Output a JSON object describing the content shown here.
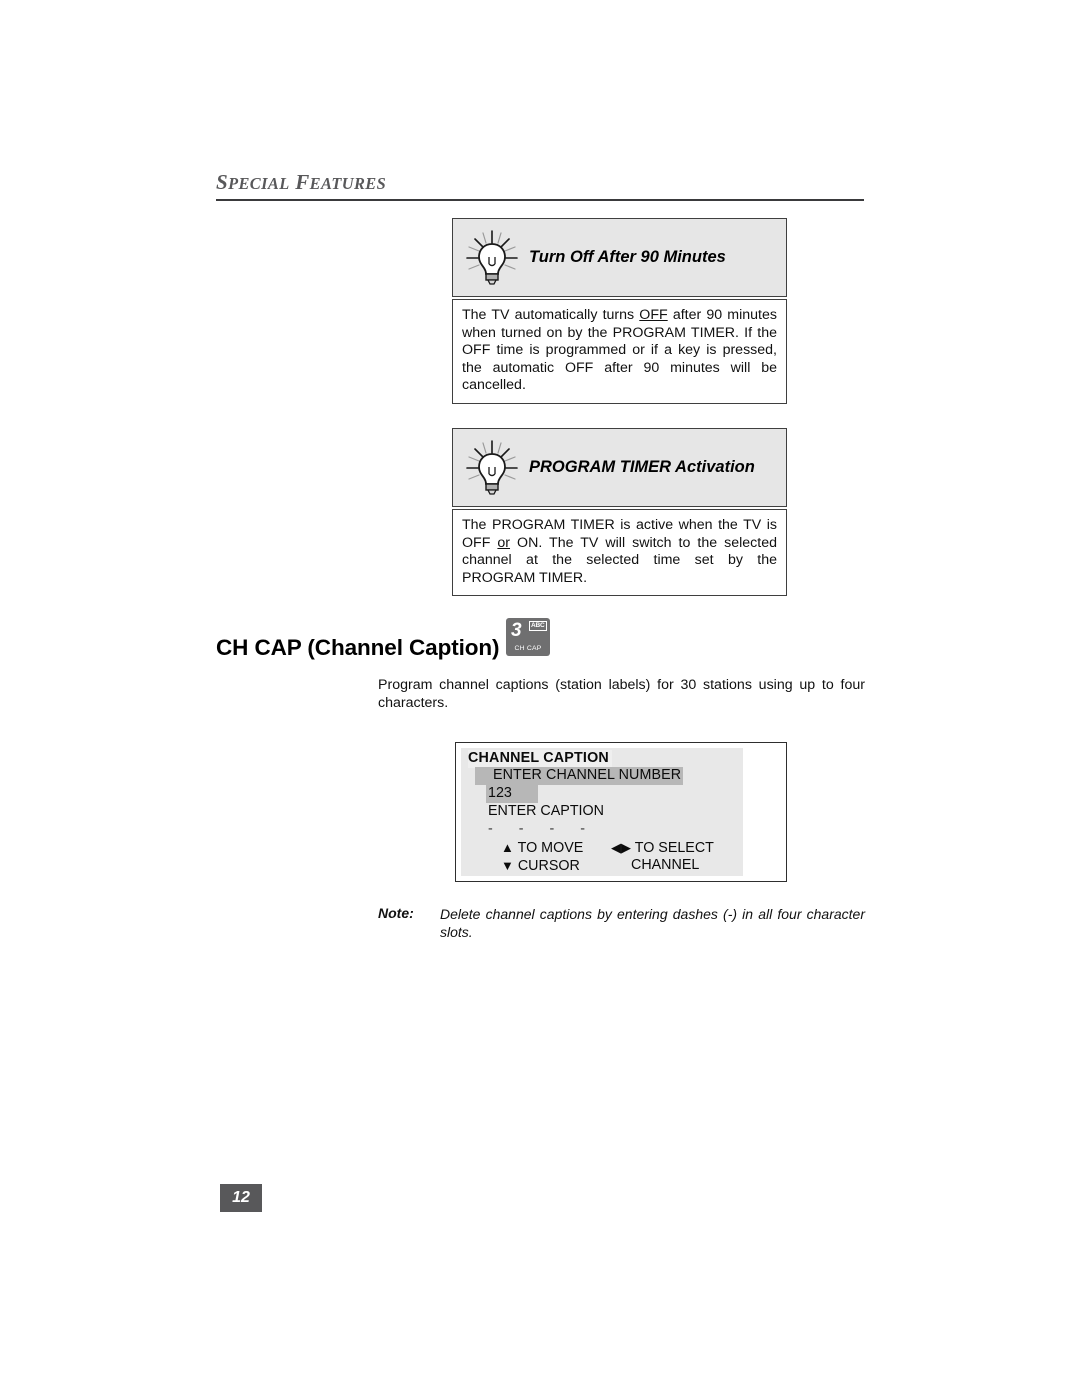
{
  "section_header": {
    "title": "SPECIAL FEATURES"
  },
  "tips": [
    {
      "icon": "lightbulb-icon",
      "title": "Turn Off After 90 Minutes",
      "body": "The TV automatically turns OFF after 90 minutes when turned on by the PROGRAM TIMER.  If the OFF time is programmed or if a key is pressed, the automatic OFF after 90 minutes will be cancelled.",
      "body_pre": "The TV automatically turns ",
      "body_underline": "OFF",
      "body_post": " after 90 minutes when turned on by the PROGRAM TIMER.  If the OFF time is programmed or if a key is pressed, the automatic OFF after 90 minutes will be cancelled."
    },
    {
      "icon": "lightbulb-icon",
      "title": "PROGRAM TIMER Activation",
      "body": "The PROGRAM TIMER is active when the TV is OFF or ON.  The TV will switch to the selected channel at the selected time set by the PROGRAM TIMER.",
      "body_pre": "The PROGRAM TIMER is active when the TV is OFF ",
      "body_underline": "or",
      "body_post": " ON.  The TV will switch to the selected channel at the selected time set by the PROGRAM TIMER."
    }
  ],
  "feature": {
    "heading": "CH CAP (Channel Caption)",
    "remote_key": {
      "number": "3",
      "letters": "ABC",
      "sublabel": "CH CAP"
    },
    "description": "Program channel captions (station labels) for 30 stations using up to four characters."
  },
  "osd": {
    "title": "CHANNEL CAPTION",
    "prompt_channel": "ENTER CHANNEL NUMBER",
    "channel_value": "123",
    "prompt_caption": "ENTER CAPTION",
    "caption_slots": "-   -   -   -",
    "legend": [
      {
        "left_arrow": "▲",
        "left_text": "TO MOVE",
        "right_arrow": "◀▶",
        "right_text": "TO SELECT"
      },
      {
        "left_arrow": "▼",
        "left_text": "CURSOR",
        "right_arrow": "",
        "right_text": "CHANNEL"
      }
    ]
  },
  "note": {
    "label": "Note:",
    "text": "Delete channel captions by entering dashes (-) in all four character slots."
  },
  "footer": {
    "page_number": "12"
  },
  "colors": {
    "tip_header_bg": "#e6e6e6",
    "osd_bg": "#e8e8e8",
    "osd_highlight": "#b7b7b7",
    "page_badge_bg": "#58585a",
    "section_head_color": "#58585a",
    "remote_key_bg": "#6f6f70"
  }
}
